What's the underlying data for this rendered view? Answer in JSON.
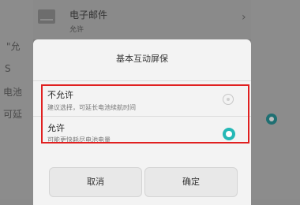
{
  "background": {
    "row": {
      "title": "电子邮件",
      "subtitle": "允许"
    },
    "left_fragments": [
      "\"允",
      "S",
      "电池",
      "可延"
    ]
  },
  "dialog": {
    "title": "基本互动屏保",
    "options": [
      {
        "title": "不允许",
        "desc": "建议选择，可延长电池续航时间",
        "selected": false
      },
      {
        "title": "允许",
        "desc": "可能更快耗尽电池电量",
        "selected": true
      }
    ],
    "buttons": {
      "cancel": "取消",
      "confirm": "确定"
    }
  },
  "colors": {
    "accent": "#25b8b6",
    "highlight": "#e02020"
  },
  "icons": {
    "mail": "mail-icon",
    "chevron": "chevron-right-icon"
  }
}
